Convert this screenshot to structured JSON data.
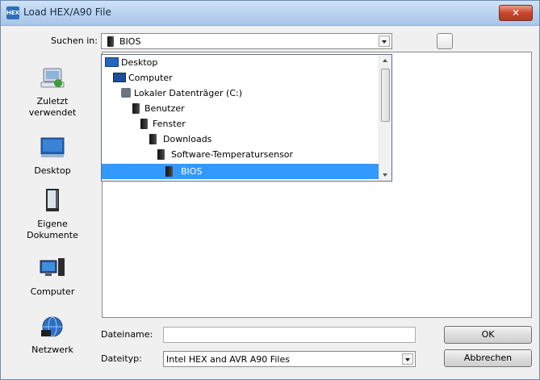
{
  "window": {
    "title": "Load HEX/A90 File",
    "close_label": "✕",
    "app_icon_text": "HEX"
  },
  "look_in": {
    "label": "Suchen in:",
    "value": "BIOS"
  },
  "dropdown": {
    "items": [
      {
        "label": "Desktop",
        "icon": "desktop-icon",
        "selected": false
      },
      {
        "label": "Computer",
        "icon": "computer-icon",
        "selected": false
      },
      {
        "label": "Lokaler Datenträger (C:)",
        "icon": "drive-icon",
        "selected": false
      },
      {
        "label": "Benutzer",
        "icon": "folder-icon",
        "selected": false
      },
      {
        "label": "Fenster",
        "icon": "folder-icon",
        "selected": false
      },
      {
        "label": "Downloads",
        "icon": "downloads-folder-icon",
        "selected": false
      },
      {
        "label": "Software-Temperatursensor",
        "icon": "folder-icon",
        "selected": false
      },
      {
        "label": "BIOS",
        "icon": "folder-icon",
        "selected": true
      }
    ]
  },
  "places": [
    {
      "label": "Zuletzt verwendet",
      "icon": "recent-places-icon"
    },
    {
      "label": "Desktop",
      "icon": "desktop-icon"
    },
    {
      "label": "Eigene Dokumente",
      "icon": "documents-icon"
    },
    {
      "label": "Computer",
      "icon": "computer-icon"
    },
    {
      "label": "Netzwerk",
      "icon": "network-icon"
    }
  ],
  "filename": {
    "label": "Dateiname:",
    "value": ""
  },
  "filetype": {
    "label": "Dateityp:",
    "value": "Intel HEX and AVR A90 Files"
  },
  "buttons": {
    "ok": "OK",
    "cancel": "Abbrechen"
  },
  "colors": {
    "selection": "#3399ff",
    "close": "#c8442d",
    "titlebar": "#b7d1ee"
  }
}
